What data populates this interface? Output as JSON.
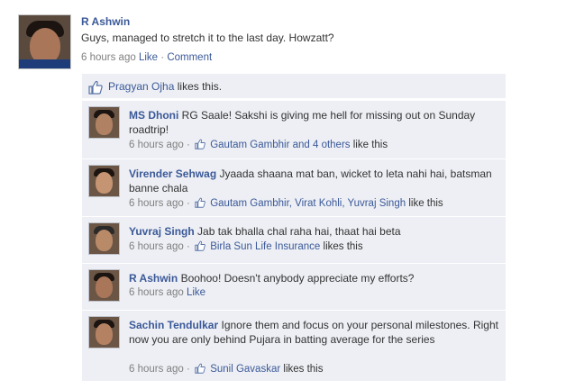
{
  "post": {
    "author": "R Ashwin",
    "text": "Guys, managed to stretch it to the last day. Howzatt?",
    "time": "6 hours ago",
    "like_label": "Like",
    "dot": "·",
    "comment_label": "Comment"
  },
  "likes": {
    "name": "Pragyan Ojha",
    "suffix": "likes this."
  },
  "comments": [
    {
      "name": "MS Dhoni",
      "text": "RG Saale! Sakshi is giving me hell for missing out on Sunday roadtrip!",
      "time": "6 hours ago",
      "dot": "·",
      "likers": "Gautam Gambhir and 4 others",
      "likes_suffix": "like this"
    },
    {
      "name": "Virender Sehwag",
      "text": "Jyaada shaana mat ban, wicket to leta nahi hai, batsman banne chala",
      "time": "6 hours ago",
      "dot": "·",
      "likers": "Gautam Gambhir, Virat Kohli, Yuvraj Singh",
      "likes_suffix": "like this"
    },
    {
      "name": "Yuvraj Singh",
      "text": "Jab tak bhalla chal raha hai, thaat hai beta",
      "time": "6 hours ago",
      "dot": "·",
      "likers": "Birla Sun Life Insurance",
      "likes_suffix": "likes this"
    },
    {
      "name": "R Ashwin",
      "text": "Boohoo! Doesn't anybody appreciate my efforts?",
      "time": "6 hours ago",
      "like_label": "Like"
    },
    {
      "name": "Sachin Tendulkar",
      "text": "Ignore them and focus on your personal milestones. Right now you are only behind Pujara in batting average for the series",
      "time": "6 hours ago",
      "dot": "·",
      "likers": "Sunil Gavaskar",
      "likes_suffix": "likes this"
    }
  ],
  "colors": {
    "link": "#3b5998",
    "thread_bg": "#edeff4",
    "meta_gray": "#808080"
  },
  "icons": {
    "like": "thumbs-up-icon",
    "avatar": "profile-photo"
  }
}
